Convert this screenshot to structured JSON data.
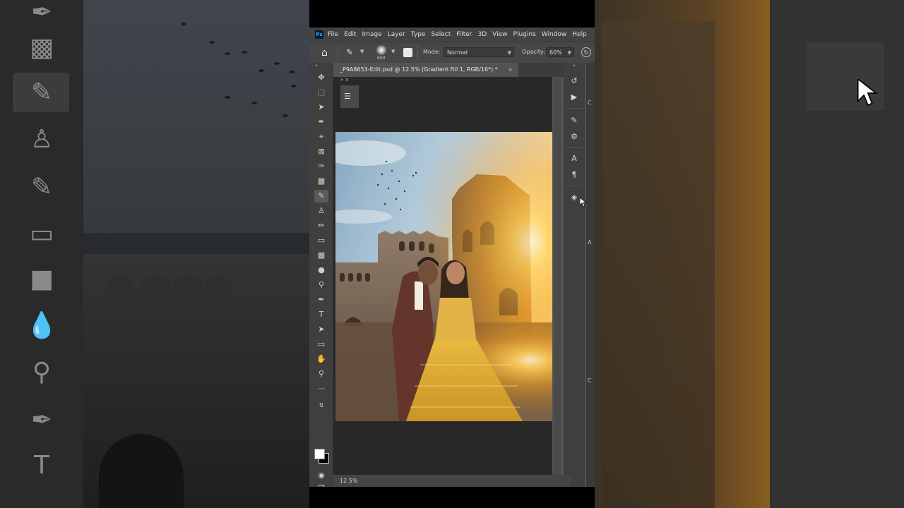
{
  "menu": {
    "app_icon": "Ps",
    "items": [
      "File",
      "Edit",
      "Image",
      "Layer",
      "Type",
      "Select",
      "Filter",
      "3D",
      "View",
      "Plugins",
      "Window",
      "Help"
    ]
  },
  "options": {
    "brush_size": "600",
    "mode_label": "Mode:",
    "mode_value": "Normal",
    "opacity_label": "Opacity:",
    "opacity_value": "60%"
  },
  "document": {
    "tab_title": "_P9A8653-Edit.psd @ 12.5% (Gradient Fill 1, RGB/16*) *",
    "zoom_status": "12.5%"
  },
  "tools": [
    {
      "name": "move-tool",
      "icon": "move-icon"
    },
    {
      "name": "marquee-tool",
      "icon": "marquee-icon"
    },
    {
      "name": "lasso-tool",
      "icon": "lasso-icon"
    },
    {
      "name": "quick-select-tool",
      "icon": "quick-select-icon"
    },
    {
      "name": "crop-tool",
      "icon": "crop-icon"
    },
    {
      "name": "frame-tool",
      "icon": "frame-icon"
    },
    {
      "name": "eyedropper-tool",
      "icon": "eyedropper-icon"
    },
    {
      "name": "healing-tool",
      "icon": "healing-icon"
    },
    {
      "name": "brush-tool",
      "icon": "brush-icon",
      "active": true
    },
    {
      "name": "stamp-tool",
      "icon": "stamp-icon"
    },
    {
      "name": "history-brush-tool",
      "icon": "history-brush-icon"
    },
    {
      "name": "eraser-tool",
      "icon": "eraser-icon"
    },
    {
      "name": "gradient-tool",
      "icon": "gradient-icon"
    },
    {
      "name": "blur-tool",
      "icon": "blur-icon"
    },
    {
      "name": "dodge-tool",
      "icon": "dodge-icon"
    },
    {
      "name": "pen-tool",
      "icon": "pen-icon"
    },
    {
      "name": "type-tool",
      "icon": "type-icon"
    },
    {
      "name": "path-select-tool",
      "icon": "path-select-icon"
    },
    {
      "name": "shape-tool",
      "icon": "rectangle-icon"
    },
    {
      "name": "hand-tool",
      "icon": "hand-icon"
    },
    {
      "name": "zoom-tool",
      "icon": "zoom-icon"
    },
    {
      "name": "more-tools",
      "icon": "ellipsis-icon"
    }
  ],
  "colors": {
    "foreground": "#ffffff",
    "background": "#000000",
    "accent": "#31a8ff"
  }
}
